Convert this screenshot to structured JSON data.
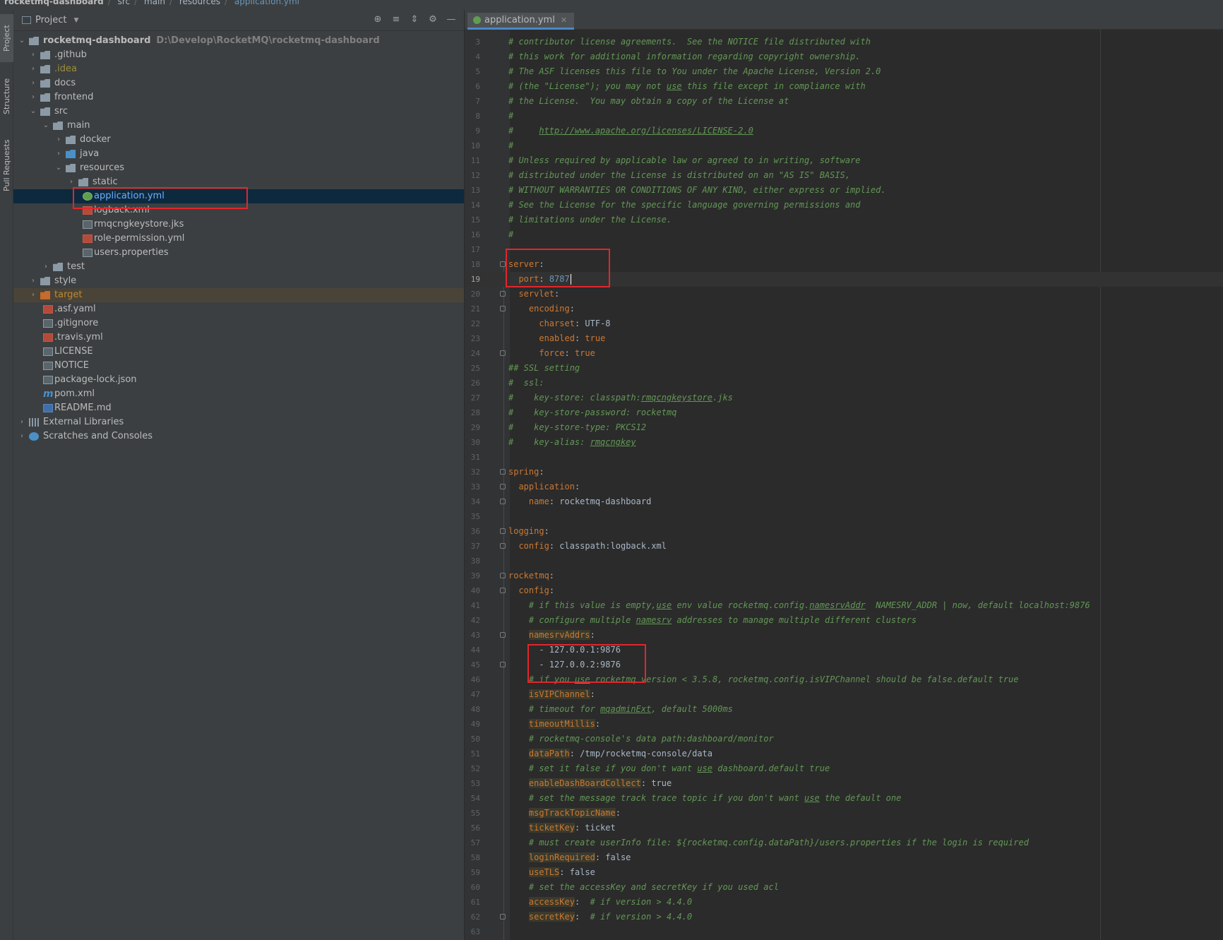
{
  "breadcrumbs": [
    "rocketmq-dashboard",
    "src",
    "main",
    "resources",
    "application.yml"
  ],
  "side_tabs": [
    "Project",
    "Structure",
    "Pull Requests"
  ],
  "project_panel": {
    "title": "Project",
    "root_name": "rocketmq-dashboard",
    "root_path": "D:\\Develop\\RocketMQ\\rocketmq-dashboard",
    "items": [
      ".github",
      ".idea",
      "docs",
      "frontend",
      "src",
      "main",
      "docker",
      "java",
      "resources",
      "static",
      "application.yml",
      "logback.xml",
      "rmqcngkeystore.jks",
      "role-permission.yml",
      "users.properties",
      "test",
      "style",
      "target",
      ".asf.yaml",
      ".gitignore",
      ".travis.yml",
      "LICENSE",
      "NOTICE",
      "package-lock.json",
      "pom.xml",
      "README.md",
      "External Libraries",
      "Scratches and Consoles"
    ]
  },
  "editor": {
    "tab_label": "application.yml",
    "current_line": 19,
    "lines": [
      {
        "n": "3",
        "t": "# contributor license agreements.  See the NOTICE file distributed with"
      },
      {
        "n": "4",
        "t": "# this work for additional information regarding copyright ownership."
      },
      {
        "n": "5",
        "t": "# The ASF licenses this file to You under the Apache License, Version 2.0"
      },
      {
        "n": "6",
        "t": "# (the \"License\"); you may not use this file except in compliance with"
      },
      {
        "n": "7",
        "t": "# the License.  You may obtain a copy of the License at"
      },
      {
        "n": "8",
        "t": "#"
      },
      {
        "n": "9",
        "t": "#     http://www.apache.org/licenses/LICENSE-2.0"
      },
      {
        "n": "10",
        "t": "#"
      },
      {
        "n": "11",
        "t": "# Unless required by applicable law or agreed to in writing, software"
      },
      {
        "n": "12",
        "t": "# distributed under the License is distributed on an \"AS IS\" BASIS,"
      },
      {
        "n": "13",
        "t": "# WITHOUT WARRANTIES OR CONDITIONS OF ANY KIND, either express or implied."
      },
      {
        "n": "14",
        "t": "# See the License for the specific language governing permissions and"
      },
      {
        "n": "15",
        "t": "# limitations under the License."
      },
      {
        "n": "16",
        "t": "#"
      },
      {
        "n": "17",
        "t": ""
      },
      {
        "n": "18",
        "t": "server:"
      },
      {
        "n": "19",
        "t": "  port: 8787"
      },
      {
        "n": "20",
        "t": "  servlet:"
      },
      {
        "n": "21",
        "t": "    encoding:"
      },
      {
        "n": "22",
        "t": "      charset: UTF-8"
      },
      {
        "n": "23",
        "t": "      enabled: true"
      },
      {
        "n": "24",
        "t": "      force: true"
      },
      {
        "n": "25",
        "t": "## SSL setting"
      },
      {
        "n": "26",
        "t": "#  ssl:"
      },
      {
        "n": "27",
        "t": "#    key-store: classpath:rmqcngkeystore.jks"
      },
      {
        "n": "28",
        "t": "#    key-store-password: rocketmq"
      },
      {
        "n": "29",
        "t": "#    key-store-type: PKCS12"
      },
      {
        "n": "30",
        "t": "#    key-alias: rmqcngkey"
      },
      {
        "n": "31",
        "t": ""
      },
      {
        "n": "32",
        "t": "spring:"
      },
      {
        "n": "33",
        "t": "  application:"
      },
      {
        "n": "34",
        "t": "    name: rocketmq-dashboard"
      },
      {
        "n": "35",
        "t": ""
      },
      {
        "n": "36",
        "t": "logging:"
      },
      {
        "n": "37",
        "t": "  config: classpath:logback.xml"
      },
      {
        "n": "38",
        "t": ""
      },
      {
        "n": "39",
        "t": "rocketmq:"
      },
      {
        "n": "40",
        "t": "  config:"
      },
      {
        "n": "41",
        "t": "    # if this value is empty,use env value rocketmq.config.namesrvAddr  NAMESRV_ADDR | now, default localhost:9876"
      },
      {
        "n": "42",
        "t": "    # configure multiple namesrv addresses to manage multiple different clusters"
      },
      {
        "n": "43",
        "t": "    namesrvAddrs:"
      },
      {
        "n": "44",
        "t": "      - 127.0.0.1:9876"
      },
      {
        "n": "45",
        "t": "      - 127.0.0.2:9876"
      },
      {
        "n": "46",
        "t": "    # if you use rocketmq version < 3.5.8, rocketmq.config.isVIPChannel should be false.default true"
      },
      {
        "n": "47",
        "t": "    isVIPChannel:"
      },
      {
        "n": "48",
        "t": "    # timeout for mqadminExt, default 5000ms"
      },
      {
        "n": "49",
        "t": "    timeoutMillis:"
      },
      {
        "n": "50",
        "t": "    # rocketmq-console's data path:dashboard/monitor"
      },
      {
        "n": "51",
        "t": "    dataPath: /tmp/rocketmq-console/data"
      },
      {
        "n": "52",
        "t": "    # set it false if you don't want use dashboard.default true"
      },
      {
        "n": "53",
        "t": "    enableDashBoardCollect: true"
      },
      {
        "n": "54",
        "t": "    # set the message track trace topic if you don't want use the default one"
      },
      {
        "n": "55",
        "t": "    msgTrackTopicName:"
      },
      {
        "n": "56",
        "t": "    ticketKey: ticket"
      },
      {
        "n": "57",
        "t": "    # must create userInfo file: ${rocketmq.config.dataPath}/users.properties if the login is required"
      },
      {
        "n": "58",
        "t": "    loginRequired: false"
      },
      {
        "n": "59",
        "t": "    useTLS: false"
      },
      {
        "n": "60",
        "t": "    # set the accessKey and secretKey if you used acl"
      },
      {
        "n": "61",
        "t": "    accessKey:  # if version > 4.4.0"
      },
      {
        "n": "62",
        "t": "    secretKey:  # if version > 4.4.0"
      },
      {
        "n": "63",
        "t": ""
      }
    ]
  },
  "colors": {
    "comment": "#629755",
    "key": "#cc7832",
    "number": "#6897bb",
    "highlight_box": "#e2262b",
    "selection": "#0d293e"
  }
}
